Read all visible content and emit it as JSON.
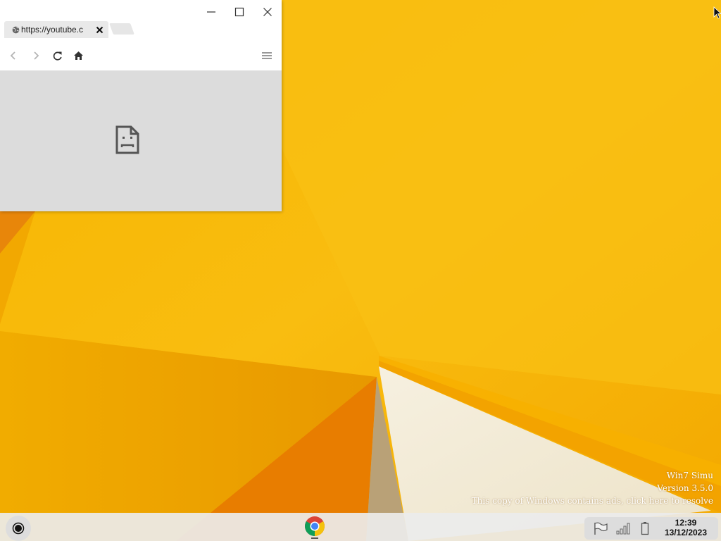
{
  "browser": {
    "tab_title": "https://youtube.c",
    "controls": {
      "minimize": "minimize-icon",
      "maximize": "maximize-icon",
      "close": "close-icon"
    },
    "toolbar_icons": [
      "back-arrow-icon",
      "forward-arrow-icon",
      "reload-icon",
      "home-icon",
      "menu-icon"
    ],
    "content_icon": "sad-page-icon"
  },
  "watermark": {
    "line1": "Win7 Simu",
    "line2": "Version 3.5.0",
    "line3": "This copy of Windows contains ads, click here to resolve"
  },
  "taskbar": {
    "start_icon": "start-icon",
    "pinned_apps": [
      "chrome-icon"
    ],
    "tray_icons": [
      "flag-icon",
      "signal-icon",
      "battery-icon"
    ],
    "time": "12:39",
    "date": "13/12/2023"
  },
  "colors": {
    "wallpaper_main": "#f4b000",
    "wallpaper_light": "#fbc520",
    "wallpaper_dark": "#e88a00",
    "taskbar": "#ececec",
    "browser_content": "#dcdcdc"
  }
}
